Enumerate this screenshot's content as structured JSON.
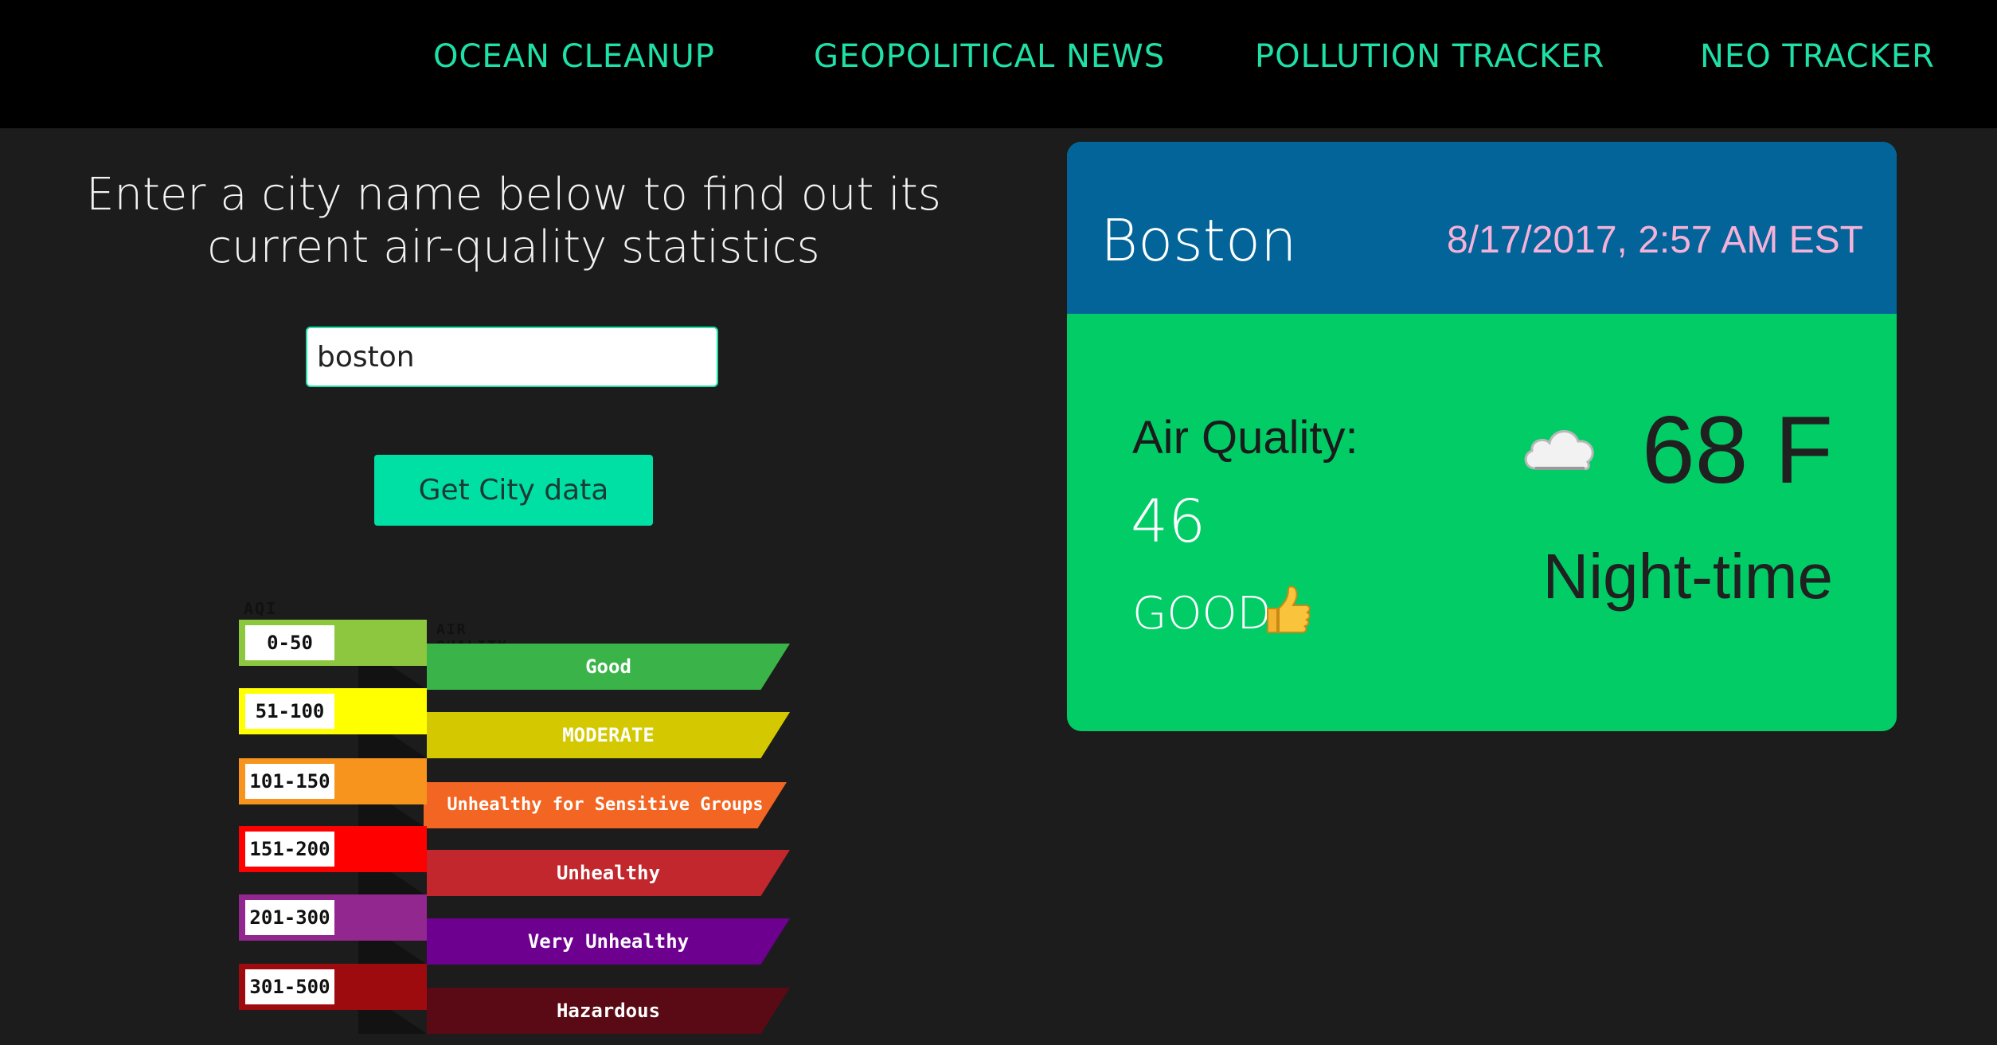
{
  "nav": {
    "items": [
      {
        "label": "OCEAN CLEANUP"
      },
      {
        "label": "GEOPOLITICAL NEWS"
      },
      {
        "label": "POLLUTION TRACKER"
      },
      {
        "label": "NEO TRACKER"
      }
    ]
  },
  "search": {
    "prompt": "Enter a city name below to find out its current air-quality statistics",
    "value": "boston",
    "button_label": "Get City data"
  },
  "legend": {
    "aqi_heading": "AQI VALUE",
    "quality_heading": "AIR QUALITY",
    "rows": [
      {
        "range": "0-50",
        "label": "Good",
        "tab_color": "#8dc63f",
        "band_color": "#3ab449"
      },
      {
        "range": "51-100",
        "label": "MODERATE",
        "tab_color": "#ffff00",
        "band_color": "#d4c800"
      },
      {
        "range": "101-150",
        "label": "Unhealthy for Sensitive Groups",
        "tab_color": "#f7941d",
        "band_color": "#f26522"
      },
      {
        "range": "151-200",
        "label": "Unhealthy",
        "tab_color": "#ff0000",
        "band_color": "#c1272d"
      },
      {
        "range": "201-300",
        "label": "Very Unhealthy",
        "tab_color": "#92278f",
        "band_color": "#6d008f"
      },
      {
        "range": "301-500",
        "label": "Hazardous",
        "tab_color": "#9e0b0f",
        "band_color": "#5a0a14"
      }
    ]
  },
  "card": {
    "city": "Boston",
    "datetime": "8/17/2017, 2:57 AM EST",
    "aq_label": "Air Quality:",
    "aq_value": "46",
    "aq_category": "GOOD",
    "category_icon": "thumbs-up-icon",
    "weather_icon": "cloud-icon",
    "temperature": "68 F",
    "time_of_day": "Night-time",
    "header_color": "#026499",
    "body_color": "#02cc66"
  }
}
